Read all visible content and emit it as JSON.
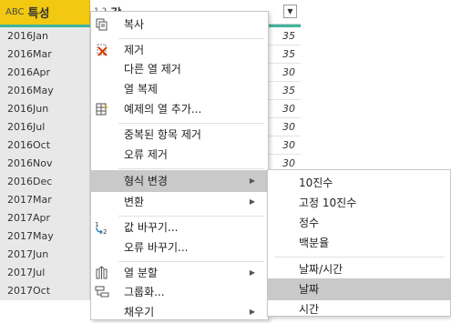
{
  "header": {
    "col1_type_icon": "ABC",
    "col1_label": "특성",
    "col2_type_icon": "1.2",
    "col2_label": "값",
    "dropdown_icon": "▼"
  },
  "rows": [
    {
      "col1": "2016Jan",
      "col2": "35"
    },
    {
      "col1": "2016Mar",
      "col2": "35"
    },
    {
      "col1": "2016Apr",
      "col2": "30"
    },
    {
      "col1": "2016May",
      "col2": "35"
    },
    {
      "col1": "2016Jun",
      "col2": "30"
    },
    {
      "col1": "2016Jul",
      "col2": "30"
    },
    {
      "col1": "2016Oct",
      "col2": "30"
    },
    {
      "col1": "2016Nov",
      "col2": "30"
    },
    {
      "col1": "2016Dec",
      "col2": ""
    },
    {
      "col1": "2017Mar",
      "col2": ""
    },
    {
      "col1": "2017Apr",
      "col2": ""
    },
    {
      "col1": "2017May",
      "col2": ""
    },
    {
      "col1": "2017Jun",
      "col2": ""
    },
    {
      "col1": "2017Jul",
      "col2": ""
    },
    {
      "col1": "2017Oct",
      "col2": ""
    }
  ],
  "menu": {
    "items": [
      {
        "label": "복사",
        "icon": "copy-icon",
        "top": 0
      },
      {
        "label": "제거",
        "icon": "remove-column-icon"
      },
      {
        "label": "다른 열 제거"
      },
      {
        "label": "열 복제"
      },
      {
        "label": "예제의 열 추가...",
        "icon": "column-from-examples-icon"
      },
      {
        "label": "중복된 항목 제거"
      },
      {
        "label": "오류 제거"
      },
      {
        "label": "형식 변경",
        "arrow": "▶"
      },
      {
        "label": "변환",
        "arrow": "▶"
      },
      {
        "label": "값 바꾸기...",
        "icon": "replace-values-icon"
      },
      {
        "label": "오류 바꾸기..."
      },
      {
        "label": "열 분할",
        "icon": "split-column-icon",
        "arrow": "▶"
      },
      {
        "label": "그룹화...",
        "icon": "group-by-icon"
      },
      {
        "label": "채우기",
        "arrow": "▶"
      }
    ]
  },
  "submenu": {
    "items": [
      {
        "label": "10진수"
      },
      {
        "label": "고정 10진수"
      },
      {
        "label": "정수"
      },
      {
        "label": "백분율"
      },
      {
        "label": "날짜/시간"
      },
      {
        "label": "날짜"
      },
      {
        "label": "시간"
      }
    ]
  },
  "colors": {
    "header_accent": "#f2c811",
    "quality_bar": "#3fb59e",
    "hover": "#c9c9c9"
  }
}
